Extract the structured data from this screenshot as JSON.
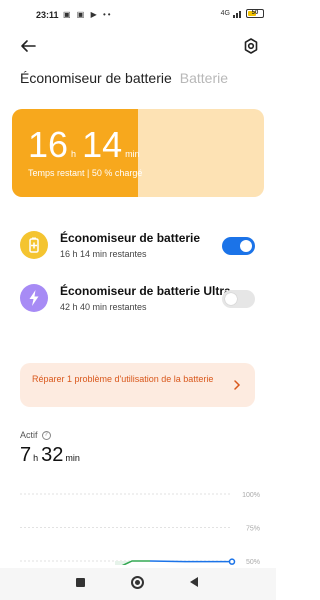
{
  "status_bar": {
    "time": "23:11",
    "left_icons": "▣ ▣ ▶ ••",
    "signal": "4G",
    "battery": "50"
  },
  "tabs": [
    {
      "label": "Économiseur de batterie",
      "active": true
    },
    {
      "label": "Batterie",
      "active": false
    }
  ],
  "hero": {
    "hours": "16",
    "hours_unit": "h",
    "minutes": "14",
    "minutes_unit": "min",
    "subtitle": "Temps restant | 50 % chargé",
    "charge_fraction": 0.5,
    "fill_color": "#f7a81d",
    "bg_color": "#fde2b4"
  },
  "rows": [
    {
      "title": "Économiseur de batterie",
      "description": "16 h 14 min restantes",
      "enabled": true,
      "icon": "battery-saver-icon",
      "icon_color": "#f4c430"
    },
    {
      "title": "Économiseur de batterie Ultra",
      "description": "42 h 40 min restantes",
      "enabled": false,
      "icon": "lightning-icon",
      "icon_color": "#a78bf5"
    }
  ],
  "fix_card": {
    "text": "Réparer 1 problème d'utilisation de la batterie"
  },
  "actif": {
    "label": "Actif",
    "hours": "7",
    "hours_unit": "h",
    "minutes": "32",
    "minutes_unit": "min"
  },
  "chart_data": {
    "type": "line",
    "ytick_labels": [
      "100%",
      "75%",
      "50%"
    ],
    "ylim": [
      50,
      100
    ],
    "series": [
      {
        "values": [
          44,
          50,
          50,
          49.5,
          49.5
        ],
        "color": "#1b73e8"
      }
    ],
    "grid": true
  }
}
